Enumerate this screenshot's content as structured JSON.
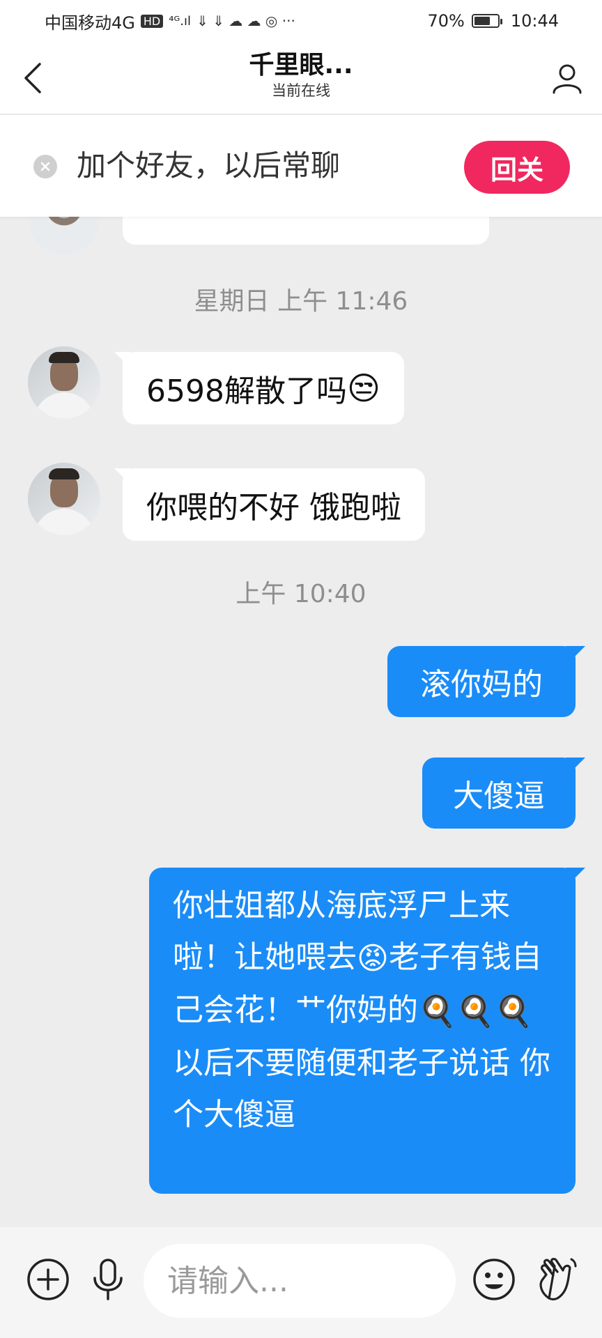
{
  "status_bar": {
    "carrier": "中国移动4G",
    "network_badge": "HD",
    "signal_text": "⁴ᴳ.ıl",
    "extra_icons": "⇓ ⇓ ☁ ☁ ◎ ···",
    "battery_percent": "70%",
    "battery_level": 0.7,
    "time": "10:44"
  },
  "header": {
    "title": "千里眼...",
    "subtitle": "当前在线"
  },
  "banner": {
    "text": "加个好友，以后常聊",
    "follow_back_label": "回关"
  },
  "chat": {
    "timestamp_1": "星期日 上午 11:46",
    "msg_1": "6598解散了吗",
    "msg_1_emoji": "😒",
    "msg_2": "你喂的不好 饿跑啦",
    "timestamp_2": "上午 10:40",
    "msg_3": "滚你妈的",
    "msg_4": "大傻逼",
    "msg_5_part1": "你壮姐都从海底浮尸上来啦！让她喂去",
    "msg_5_emoji1": "😡",
    "msg_5_part2": "老子有钱自己会花！艹你妈的",
    "msg_5_emoji2": "🍳🍳🍳",
    "msg_5_part3": "以后不要随便和老子说话 你个大傻逼"
  },
  "input_bar": {
    "placeholder": "请输入..."
  },
  "colors": {
    "accent_blue": "#1a8cf8",
    "follow_pink": "#f0285f",
    "chat_bg": "#ededed"
  },
  "icons": [
    "back-icon",
    "profile-icon",
    "close-icon",
    "plus-icon",
    "mic-icon",
    "emoji-icon",
    "wave-hand-icon"
  ]
}
